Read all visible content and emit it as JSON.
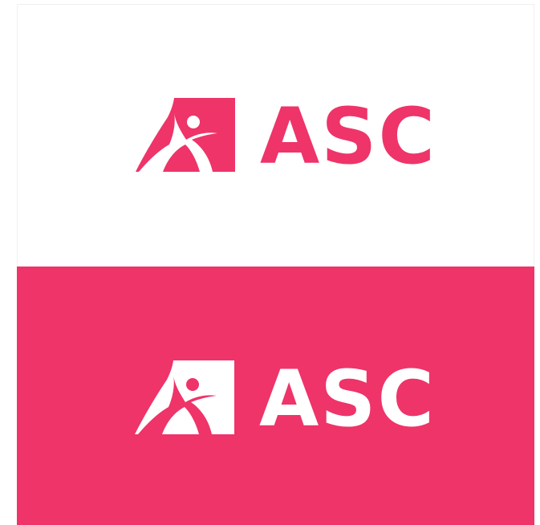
{
  "brand": {
    "name": "ASC",
    "pink": "#ee3469",
    "white": "#ffffff"
  },
  "variants": [
    {
      "background": "white",
      "logo_color": "pink",
      "mark_icon": "figure-arch-logo-icon"
    },
    {
      "background": "pink",
      "logo_color": "white",
      "mark_icon": "figure-arch-logo-icon"
    }
  ]
}
